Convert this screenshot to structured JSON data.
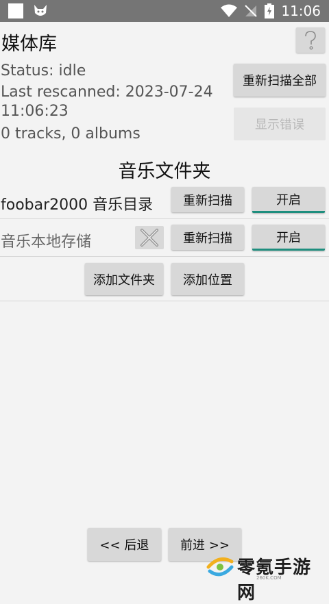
{
  "status_bar": {
    "time": "11:06",
    "icons": [
      "notification-square-icon",
      "cat-icon",
      "wifi-icon",
      "no-sim-icon",
      "battery-icon"
    ]
  },
  "header": {
    "title": "媒体库",
    "help_label": "?"
  },
  "info": {
    "status": "Status: idle",
    "last_rescanned_line1": "Last rescanned: 2023-07-24",
    "last_rescanned_line2": "11:06:23",
    "counts": "0 tracks, 0 albums"
  },
  "actions": {
    "rescan_all_label": "重新扫描全部",
    "show_errors_label": "显示错误"
  },
  "folders_section": {
    "title": "音乐文件夹",
    "items": [
      {
        "name": "foobar2000 音乐目录",
        "rescan_label": "重新扫描",
        "toggle_label": "开启"
      },
      {
        "name": "音乐本地存储",
        "rescan_label": "重新扫描",
        "toggle_label": "开启"
      }
    ],
    "add_folder_label": "添加文件夹",
    "add_location_label": "添加位置"
  },
  "navigation": {
    "back_label": "<< 后退",
    "forward_label": "前进 >>"
  },
  "watermark": {
    "text": "零氪手游网",
    "sub": "260K.COM"
  },
  "colors": {
    "accent": "#1e8e7e",
    "button": "#d8d8d8",
    "statusbar": "#757575"
  }
}
